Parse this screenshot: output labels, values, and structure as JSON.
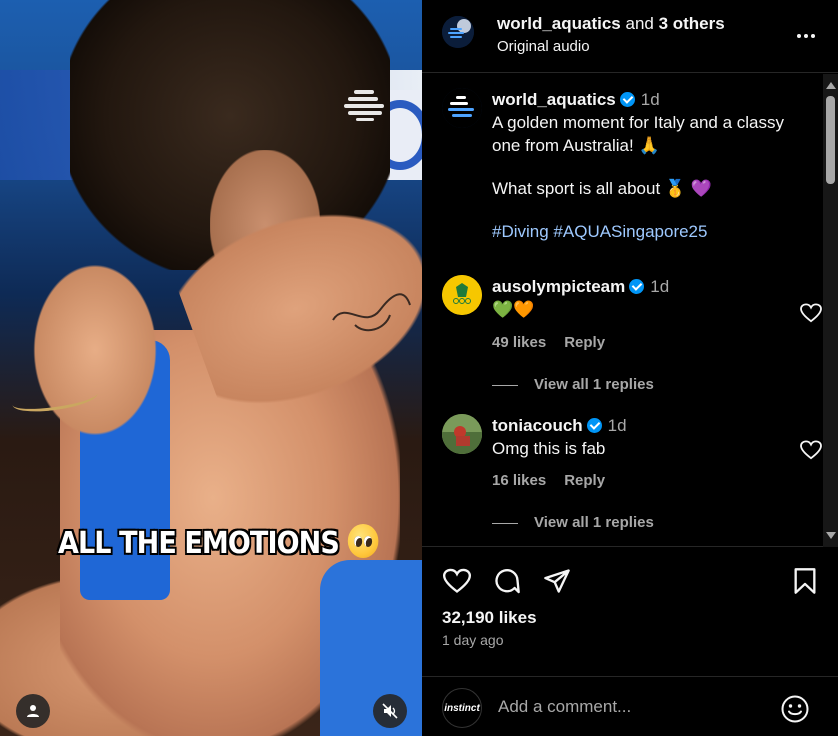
{
  "media": {
    "overlay_text": "ALL THE EMOTIONS",
    "tag_icon": "person-icon",
    "mute_icon": "speaker-muted-icon"
  },
  "header": {
    "username": "world_aquatics",
    "and": " and ",
    "others": "3 others",
    "audio": "Original audio"
  },
  "caption": {
    "username": "world_aquatics",
    "time": "1d",
    "line1": "A golden moment for Italy and a classy one from Australia! 🙏",
    "line2": "What sport is all about 🥇 💜",
    "hashtags": "#Diving #AQUASingapore25"
  },
  "comments": [
    {
      "username": "ausolympicteam",
      "time": "1d",
      "text": "💚🧡",
      "likes": "49 likes",
      "reply": "Reply",
      "view_replies": "View all 1 replies"
    },
    {
      "username": "toniacouch",
      "time": "1d",
      "text": "Omg this is fab",
      "likes": "16 likes",
      "reply": "Reply",
      "view_replies": "View all 1 replies"
    }
  ],
  "stats": {
    "likes": "32,190 likes",
    "posted": "1 day ago"
  },
  "composer": {
    "placeholder": "Add a comment...",
    "avatar_text": "instinct"
  },
  "colors": {
    "background": "#000000",
    "text": "#f5f5f5",
    "secondary": "#a8a8a8",
    "verified": "#0095f6",
    "hashtag": "#e0f1ff"
  }
}
